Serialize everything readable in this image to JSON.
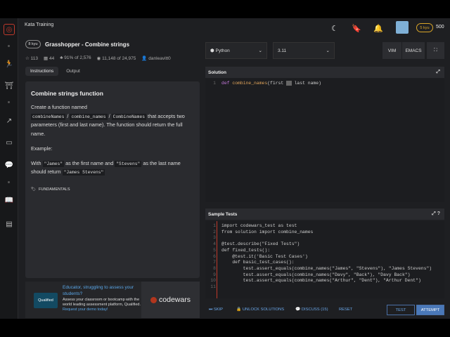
{
  "header": {
    "section": "Kata Training",
    "honor": "500",
    "rank_badge": "5 kyu",
    "icons": [
      "moon-icon",
      "bookmark-icon",
      "bell-icon"
    ]
  },
  "kata": {
    "kyu": "8 kyu",
    "title": "Grasshopper - Combine strings",
    "stats": {
      "stars": "113",
      "collections": "44",
      "satisfaction": "91% of 2,576",
      "completed": "11,148 of 24,975",
      "author": "danleavitt0"
    },
    "tabs": [
      "Instructions",
      "Output"
    ]
  },
  "description": {
    "heading": "Combine strings function",
    "p1a": "Create a function named",
    "fn1": "combineNames",
    "sep1": " / ",
    "fn2": "combine_names",
    "sep2": " / ",
    "fn3": "CombineNames",
    "p1b": " that accepts two parameters (first and last name). The function should return the full name.",
    "example_label": "Example:",
    "with": "With ",
    "arg1": "\"James\"",
    "mid": " as the first name and ",
    "arg2": "\"Stevens\"",
    "tail": " as the last name should return ",
    "result": "\"James Stevens\"",
    "tag": "FUNDAMENTALS"
  },
  "ad": {
    "logo": "Qualified",
    "headline": "Educator, struggling to assess your students?",
    "body": "Assess your classroom or bootcamp with the world leading assessment platform, Qualified.",
    "link": "Request your demo today!",
    "brand": "codewars"
  },
  "editor_controls": {
    "language": "Python",
    "version": "3.11",
    "vim": "VIM",
    "emacs": "EMACS"
  },
  "solution": {
    "title": "Solution",
    "line_numbers": [
      "1"
    ],
    "lines": [
      "def combine_names(first  last name)"
    ]
  },
  "tests": {
    "title": "Sample Tests",
    "line_numbers": [
      "1",
      "2",
      "3",
      "4",
      "5",
      "6",
      "7",
      "8",
      "9",
      "10",
      "11"
    ],
    "lines": [
      "import codewars_test as test",
      "from solution import combine_names",
      "",
      "@test.describe(\"Fixed Tests\")",
      "def fixed_tests():",
      "    @test.it('Basic Test Cases')",
      "    def basic_test_cases():",
      "        test.assert_equals(combine_names(\"James\", \"Stevens\"), \"James Stevens\")",
      "        test.assert_equals(combine_names(\"Davy\", \"Back\"), \"Davy Back\")",
      "        test.assert_equals(combine_names(\"Arthur\", \"Dent\"), \"Arthur Dent\")",
      ""
    ]
  },
  "actions": {
    "skip": "SKIP",
    "unlock": "UNLOCK SOLUTIONS",
    "discuss": "DISCUSS (15)",
    "reset": "RESET",
    "test": "TEST",
    "attempt": "ATTEMPT"
  }
}
